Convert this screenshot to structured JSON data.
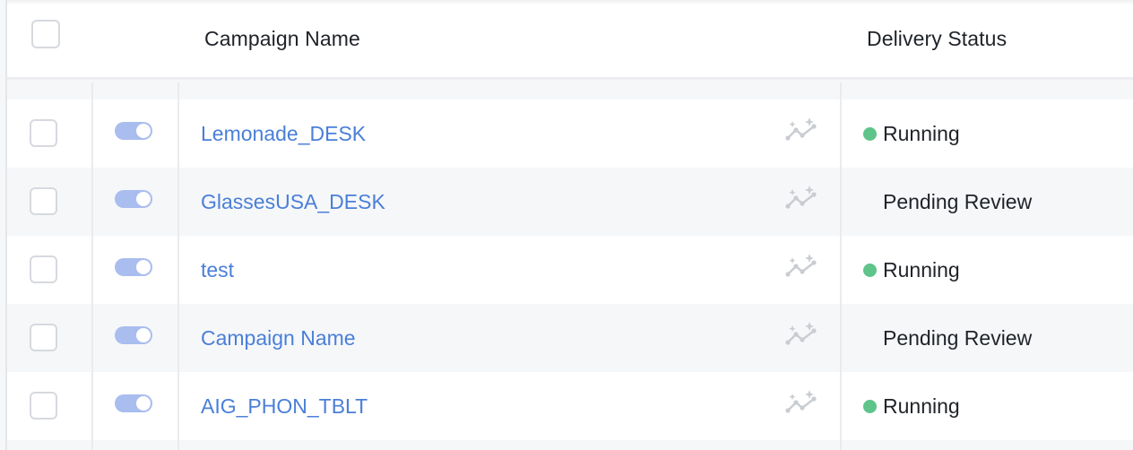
{
  "header": {
    "campaign_name": "Campaign Name",
    "delivery_status": "Delivery Status"
  },
  "colors": {
    "link": "#4a7fd8",
    "running_dot": "#5ec48a",
    "toggle_on": "#a9bdee"
  },
  "rows": [
    {
      "name": "Lemonade_DESK",
      "status": "Running",
      "status_dot": true,
      "toggle_on": true,
      "insights_icon": "sparkle-trend-icon"
    },
    {
      "name": "GlassesUSA_DESK",
      "status": "Pending Review",
      "status_dot": false,
      "toggle_on": true,
      "insights_icon": "sparkle-trend-icon"
    },
    {
      "name": "test",
      "status": "Running",
      "status_dot": true,
      "toggle_on": true,
      "insights_icon": "sparkle-trend-icon"
    },
    {
      "name": "Campaign Name",
      "status": "Pending Review",
      "status_dot": false,
      "toggle_on": true,
      "insights_icon": "sparkle-trend-icon"
    },
    {
      "name": "AIG_PHON_TBLT",
      "status": "Running",
      "status_dot": true,
      "toggle_on": true,
      "insights_icon": "sparkle-trend-icon"
    }
  ]
}
